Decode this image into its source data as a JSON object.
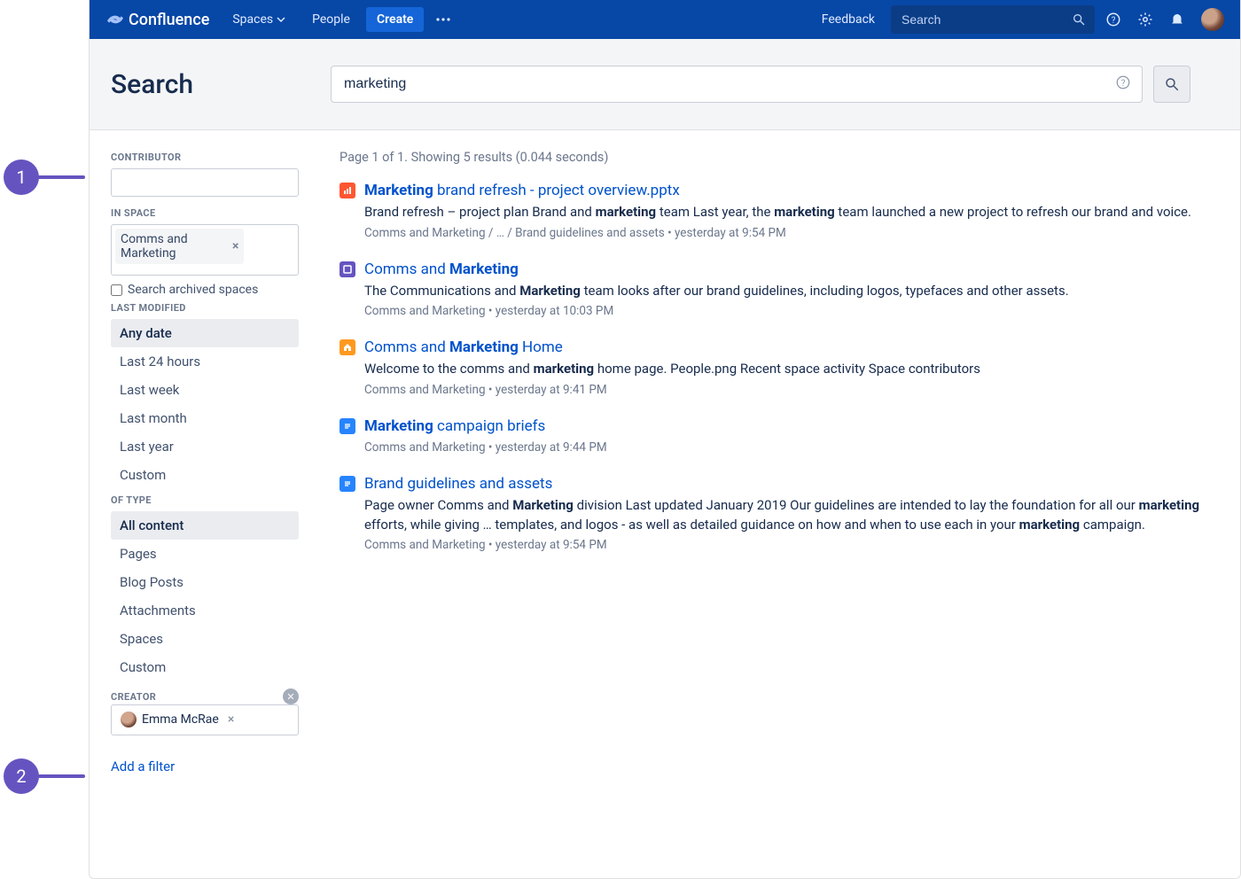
{
  "nav": {
    "brand": "Confluence",
    "items": [
      "Spaces",
      "People"
    ],
    "create": "Create",
    "feedback": "Feedback",
    "search_placeholder": "Search"
  },
  "search": {
    "title": "Search",
    "query": "marketing"
  },
  "filters": {
    "contributor_label": "CONTRIBUTOR",
    "in_space_label": "IN SPACE",
    "space_chip": "Comms and Marketing",
    "archived_label": "Search archived spaces",
    "last_modified_label": "LAST MODIFIED",
    "last_modified_options": [
      "Any date",
      "Last 24 hours",
      "Last week",
      "Last month",
      "Last year",
      "Custom"
    ],
    "last_modified_selected": 0,
    "of_type_label": "OF TYPE",
    "of_type_options": [
      "All content",
      "Pages",
      "Blog Posts",
      "Attachments",
      "Spaces",
      "Custom"
    ],
    "of_type_selected": 0,
    "creator_label": "CREATOR",
    "creator_chip": "Emma McRae",
    "add_filter": "Add a filter"
  },
  "results": {
    "meta": "Page 1 of 1. Showing 5 results (0.044 seconds)",
    "items": [
      {
        "icon": "ppt",
        "title_html": "<b>Marketing</b> brand refresh - project overview.pptx",
        "snippet_html": "Brand refresh – project plan Brand and <b>marketing</b> team Last year, the <b>marketing</b> team launched a new project to refresh our brand and voice.",
        "path": "Comms and Marketing / … / Brand guidelines and assets • yesterday at 9:54 PM"
      },
      {
        "icon": "space",
        "title_html": "Comms and <b>Marketing</b>",
        "snippet_html": "The Communications and <b>Marketing</b> team looks after our brand guidelines, including logos, typefaces and other assets.",
        "path": "Comms and Marketing • yesterday at 10:03 PM"
      },
      {
        "icon": "home",
        "title_html": "Comms and <b>Marketing</b> Home",
        "snippet_html": "Welcome to the comms and <b>marketing</b> home page. People.png Recent space activity Space contributors",
        "path": "Comms and Marketing • yesterday at 9:41 PM"
      },
      {
        "icon": "page",
        "title_html": "<b>Marketing</b> campaign briefs",
        "snippet_html": "",
        "path": "Comms and Marketing • yesterday at 9:44 PM"
      },
      {
        "icon": "page",
        "title_html": "Brand guidelines and assets",
        "snippet_html": "Page owner Comms and <b>Marketing</b> division Last updated January 2019 Our guidelines are intended to lay the foundation for all our <b>marketing</b> efforts, while giving … templates, and logos - as well as detailed guidance on how and when to use each in your <b>marketing</b> campaign.",
        "path": "Comms and Marketing • yesterday at 9:54 PM"
      }
    ]
  },
  "annotations": {
    "one": "1",
    "two": "2"
  }
}
